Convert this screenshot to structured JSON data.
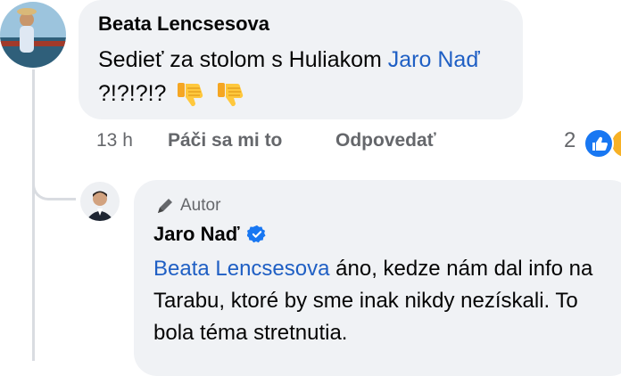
{
  "comment": {
    "author": "Beata Lencsesova",
    "text_before": "Sedieť za stolom s Huliakom ",
    "mention": "Jaro Nаď",
    "text_after": " ?!?!?!?",
    "emojis": [
      "thumbs-down-emoji",
      "thumbs-down-emoji"
    ],
    "time": "13 h",
    "like_label": "Páči sa mi to",
    "reply_label": "Odpovedať",
    "reaction_count": "2"
  },
  "reply": {
    "badge_label": "Autor",
    "author": "Jaro Naď",
    "verified": true,
    "mention": "Beata Lencsesova",
    "text": " áno, kedze nám dal info na Tarabu, ktoré by sme inak nikdy nezískali. To bola téma stretnutia."
  },
  "colors": {
    "link": "#1f5fc4",
    "bubble": "#f0f2f5",
    "meta": "#65676b",
    "verified": "#1877f2"
  }
}
